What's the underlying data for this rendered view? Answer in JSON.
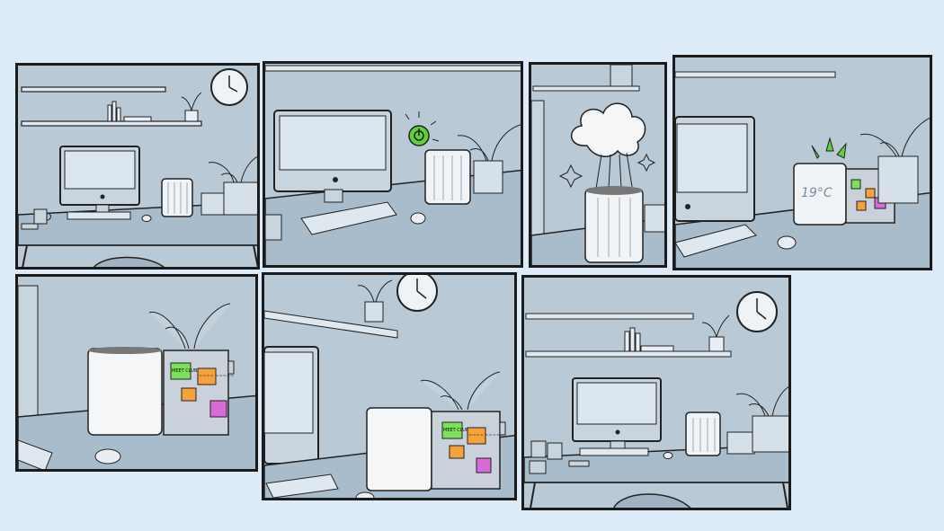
{
  "comic": {
    "background": "#ddeaf7",
    "panel_fill": "#b9c9d6",
    "accent_green": "#5fd13a",
    "note_colors": {
      "green": "#7de05a",
      "orange": "#f6a23b",
      "magenta": "#d96bd9"
    },
    "icons": [
      "wall-clock-icon",
      "power-button-icon",
      "apple-logo-icon",
      "sparkle-icon",
      "smoke-cloud-icon"
    ]
  },
  "panel4": {
    "temperature": "19°C"
  },
  "panel5": {
    "note_meet": "MEET CLUB",
    "note_scribble": "~~~~ ~~~~~"
  },
  "panel6": {
    "note_meet": "MEET CLUB",
    "note_scribble": "~~~~ ~~~~~"
  }
}
